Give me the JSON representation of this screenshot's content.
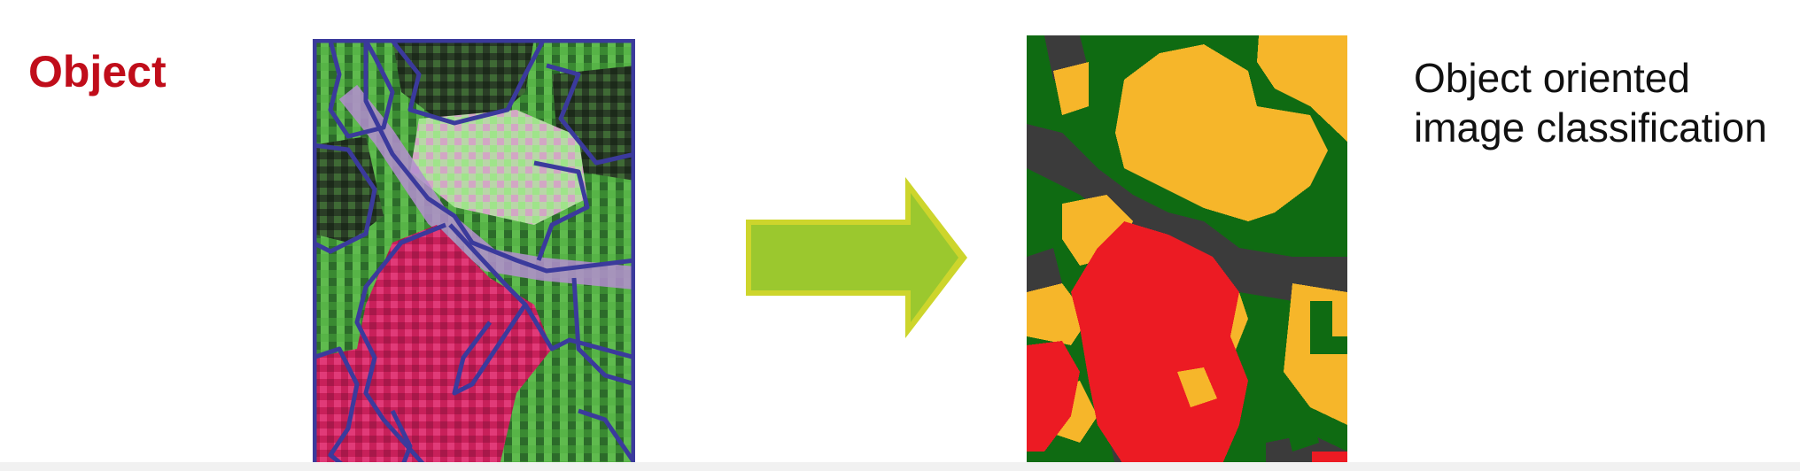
{
  "slide": {
    "heading": "Object",
    "caption_line1": "Object oriented",
    "caption_line2": "image classification"
  },
  "colors": {
    "heading": "#c00d1a",
    "segment_outline": "#3b3a9c",
    "arrow_fill": "#9bc82e",
    "arrow_edge": "#cdd52c",
    "class_forest": "#0f6b12",
    "class_road": "#3b3b3b",
    "class_grass": "#f6b62a",
    "class_crop": "#ec1b23"
  },
  "icons": {
    "arrow": "right-arrow-icon"
  }
}
